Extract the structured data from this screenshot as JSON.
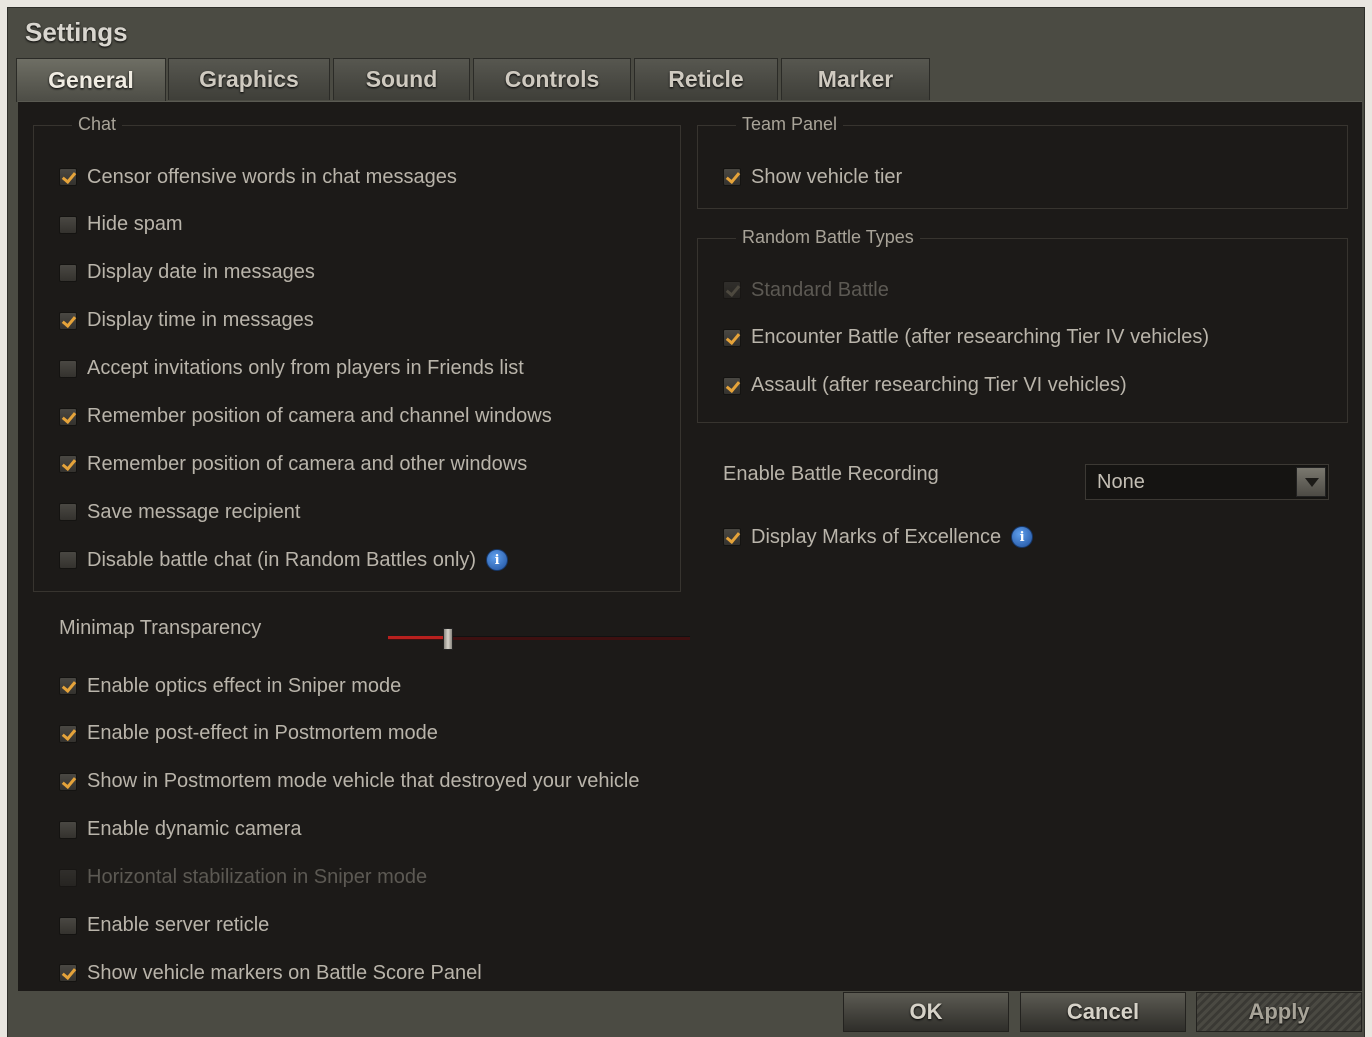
{
  "window": {
    "title": "Settings"
  },
  "tabs": [
    "General",
    "Graphics",
    "Sound",
    "Controls",
    "Reticle",
    "Marker"
  ],
  "chat": {
    "legend": "Chat",
    "options": [
      {
        "label": "Censor offensive words in chat messages",
        "checked": true
      },
      {
        "label": "Hide spam",
        "checked": false
      },
      {
        "label": "Display date in messages",
        "checked": false
      },
      {
        "label": "Display time in messages",
        "checked": true
      },
      {
        "label": "Accept invitations only from players in Friends list",
        "checked": false
      },
      {
        "label": "Remember position of camera and channel windows",
        "checked": true
      },
      {
        "label": "Remember position of camera and other windows",
        "checked": true
      },
      {
        "label": "Save message recipient",
        "checked": false
      },
      {
        "label": "Disable battle chat (in Random Battles only)",
        "checked": false,
        "info": true
      }
    ]
  },
  "minimap": {
    "label": "Minimap Transparency",
    "value_fraction": 0.2
  },
  "general_options": [
    {
      "label": "Enable optics effect in Sniper mode",
      "checked": true
    },
    {
      "label": "Enable post-effect in Postmortem mode",
      "checked": true
    },
    {
      "label": "Show in Postmortem mode vehicle that destroyed your vehicle",
      "checked": true
    },
    {
      "label": "Enable dynamic camera",
      "checked": false
    },
    {
      "label": "Horizontal stabilization in Sniper mode",
      "checked": false,
      "disabled": true
    },
    {
      "label": "Enable server reticle",
      "checked": false
    },
    {
      "label": "Show vehicle markers on Battle Score Panel",
      "checked": true
    }
  ],
  "team_panel": {
    "legend": "Team Panel",
    "options": [
      {
        "label": "Show vehicle tier",
        "checked": true
      }
    ]
  },
  "random_battle": {
    "legend": "Random Battle Types",
    "options": [
      {
        "label": "Standard Battle",
        "checked": true,
        "disabled": true
      },
      {
        "label": "Encounter Battle (after researching Tier IV vehicles)",
        "checked": true
      },
      {
        "label": "Assault (after researching Tier VI vehicles)",
        "checked": true
      }
    ]
  },
  "battle_recording": {
    "label": "Enable Battle Recording",
    "value": "None"
  },
  "marks_excellence": {
    "label": "Display Marks of Excellence",
    "checked": true,
    "info": true
  },
  "buttons": {
    "ok": "OK",
    "cancel": "Cancel",
    "apply": "Apply"
  },
  "colors": {
    "accent_check": "#e5a33a",
    "slider_fill": "#b8201e",
    "info_icon": "#3a7bd5"
  }
}
